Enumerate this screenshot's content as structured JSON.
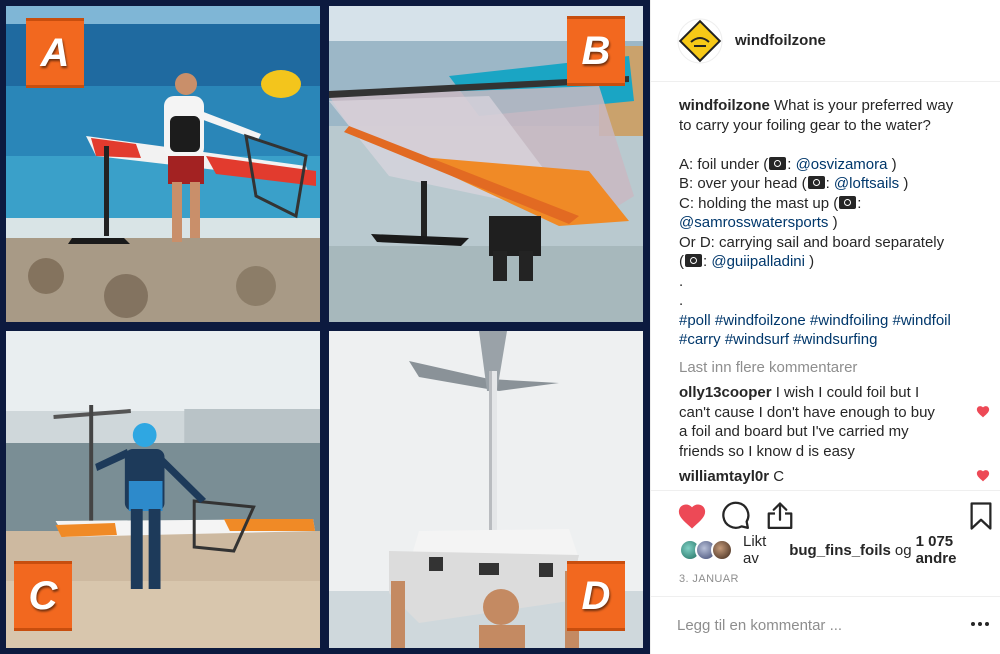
{
  "badges": {
    "a": "A",
    "b": "B",
    "c": "C",
    "d": "D"
  },
  "post": {
    "username": "windfoilzone",
    "caption": {
      "user": "windfoilzone",
      "line1": "What is your preferred way",
      "line2": "to carry your foiling gear to the water?",
      "opt_a_text": "A: foil under (",
      "opt_a_mention": "@osvizamora",
      "opt_a_end": ")",
      "opt_b_text": "B: over your head (",
      "opt_b_mention": "@loftsails",
      "opt_b_end": ")",
      "opt_c_text": "C: holding the mast up (",
      "opt_c_colon": ":",
      "opt_c_mention": "@samrosswatersports",
      "opt_c_end": ")",
      "opt_d_text": "Or D: carrying sail and board separately",
      "opt_d_open": "(",
      "opt_d_mention": "@guiipalladini",
      "opt_d_end": ")",
      "dot1": ".",
      "dot2": ".",
      "tags_line1": "#poll #windfoilzone #windfoiling #windfoil",
      "tags_line2": "#carry #windsurf #windsurfing"
    },
    "load_more": "Last inn flere kommentarer",
    "comments": [
      {
        "user": "olly13cooper",
        "text_l1": "I wish I could foil but I",
        "text_l2": "can't cause I don't have enough to buy",
        "text_l3": "a foil and board but I've carried my",
        "text_l4": "friends so I know d is easy"
      },
      {
        "user": "williamtayl0r",
        "text": "C"
      }
    ],
    "likes": {
      "prefix": "Likt av",
      "user": "bug_fins_foils",
      "and": "og",
      "count": "1 075 andre"
    },
    "date": "3. JANUAR",
    "add_comment_placeholder": "Legg til en kommentar ...",
    "more_icon": "•••"
  },
  "colors": {
    "accent_orange": "#f2681f",
    "collage_bg": "#0c1a3f",
    "like_red": "#ed4956",
    "link_blue": "#00376b",
    "muted_gray": "#8e8e8e"
  }
}
